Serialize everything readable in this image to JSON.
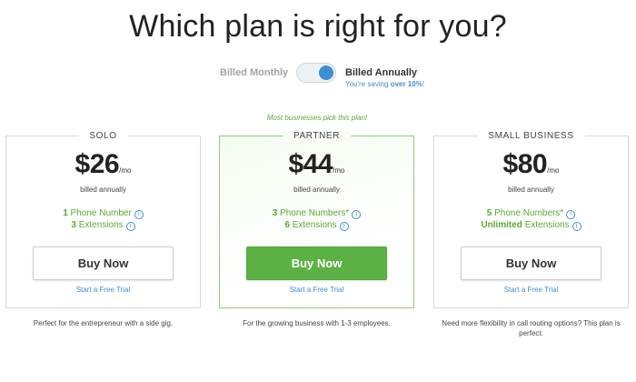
{
  "title": "Which plan is right for you?",
  "billing": {
    "monthly_label": "Billed Monthly",
    "annual_label": "Billed Annually",
    "saving_prefix": "You're saving ",
    "saving_highlight": "over 10%",
    "saving_suffix": "!",
    "selected": "annually"
  },
  "recommend_note": "Most businesses pick this plan!",
  "plans": [
    {
      "name": "SOLO",
      "currency": "$",
      "price": "26",
      "per": "/mo",
      "billed": "billed annually",
      "feature1_num": "1",
      "feature1_text": " Phone Number",
      "feature2_num": "3",
      "feature2_text": " Extensions",
      "buy_label": "Buy Now",
      "trial_label": "Start a Free Trial",
      "description": "Perfect for the entrepreneur with a side gig."
    },
    {
      "name": "PARTNER",
      "currency": "$",
      "price": "44",
      "per": "/mo",
      "billed": "billed annually",
      "feature1_num": "3",
      "feature1_text": " Phone Numbers*",
      "feature2_num": "6",
      "feature2_text": " Extensions",
      "buy_label": "Buy Now",
      "trial_label": "Start a Free Trial",
      "description": "For the growing business with 1-3 employees."
    },
    {
      "name": "SMALL BUSINESS",
      "currency": "$",
      "price": "80",
      "per": "/mo",
      "billed": "billed annually",
      "feature1_num": "5",
      "feature1_text": " Phone Numbers*",
      "feature2_num": "Unlimited",
      "feature2_text": " Extensions",
      "buy_label": "Buy Now",
      "trial_label": "Start a Free Trial",
      "description": "Need more flexibility in call routing options? This plan is perfect."
    }
  ],
  "info_icon_glyph": "i",
  "colors": {
    "accent_green": "#5cb144",
    "feature_green": "#58a936",
    "link_blue": "#3f8fd2"
  }
}
